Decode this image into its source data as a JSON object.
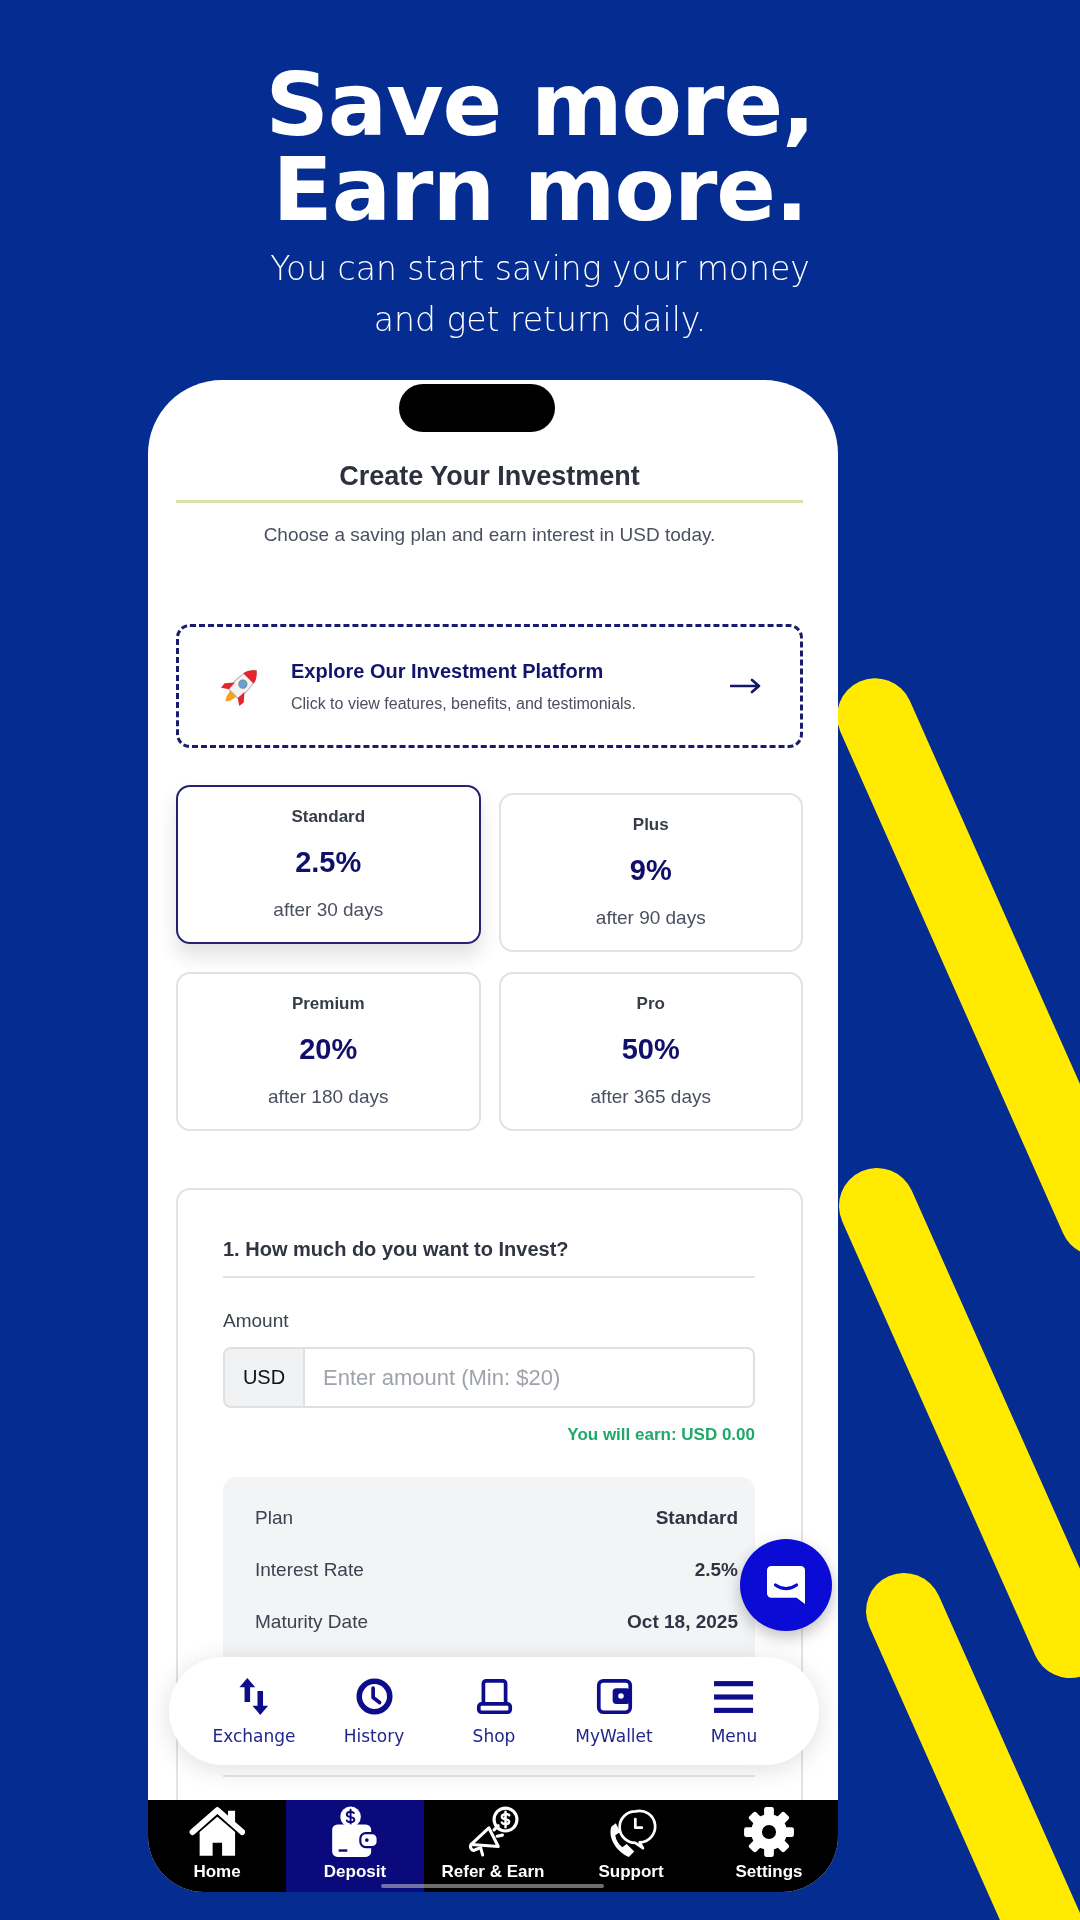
{
  "hero": {
    "headline_lines": [
      "Save more,",
      "Earn more."
    ],
    "tagline_lines": [
      "You can start saving your money",
      "and get return daily."
    ]
  },
  "screen": {
    "title": "Create Your Investment",
    "subtitle": "Choose a saving plan and earn interest in USD today."
  },
  "explore_card": {
    "title": "Explore Our Investment Platform",
    "description": "Click to view features, benefits, and testimonials."
  },
  "plans": [
    {
      "name": "Standard",
      "rate": "2.5%",
      "term": "after 30 days",
      "selected": true
    },
    {
      "name": "Plus",
      "rate": "9%",
      "term": "after 90 days",
      "selected": false
    },
    {
      "name": "Premium",
      "rate": "20%",
      "term": "after 180 days",
      "selected": false
    },
    {
      "name": "Pro",
      "rate": "50%",
      "term": "after 365 days",
      "selected": false
    }
  ],
  "invest_form": {
    "question": "1. How much do you want to Invest?",
    "amount_label": "Amount",
    "currency": "USD",
    "placeholder": "Enter amount (Min: $20)",
    "earnings": "You will earn: USD 0.00",
    "summary": [
      {
        "label": "Plan",
        "value": "Standard"
      },
      {
        "label": "Interest Rate",
        "value": "2.5%"
      },
      {
        "label": "Maturity Date",
        "value": "Oct 18, 2025"
      }
    ]
  },
  "quick_nav": [
    {
      "kind": "exchange",
      "label": "Exchange"
    },
    {
      "kind": "history",
      "label": "History"
    },
    {
      "kind": "shop",
      "label": "Shop"
    },
    {
      "kind": "wallet",
      "label": "MyWallet"
    },
    {
      "kind": "menu",
      "label": "Menu"
    }
  ],
  "tab_bar": [
    {
      "kind": "home",
      "label": "Home",
      "selected": false
    },
    {
      "kind": "deposit",
      "label": "Deposit",
      "selected": true
    },
    {
      "kind": "refer",
      "label": "Refer & Earn",
      "selected": false
    },
    {
      "kind": "support",
      "label": "Support",
      "selected": false
    },
    {
      "kind": "settings",
      "label": "Settings",
      "selected": false
    }
  ]
}
